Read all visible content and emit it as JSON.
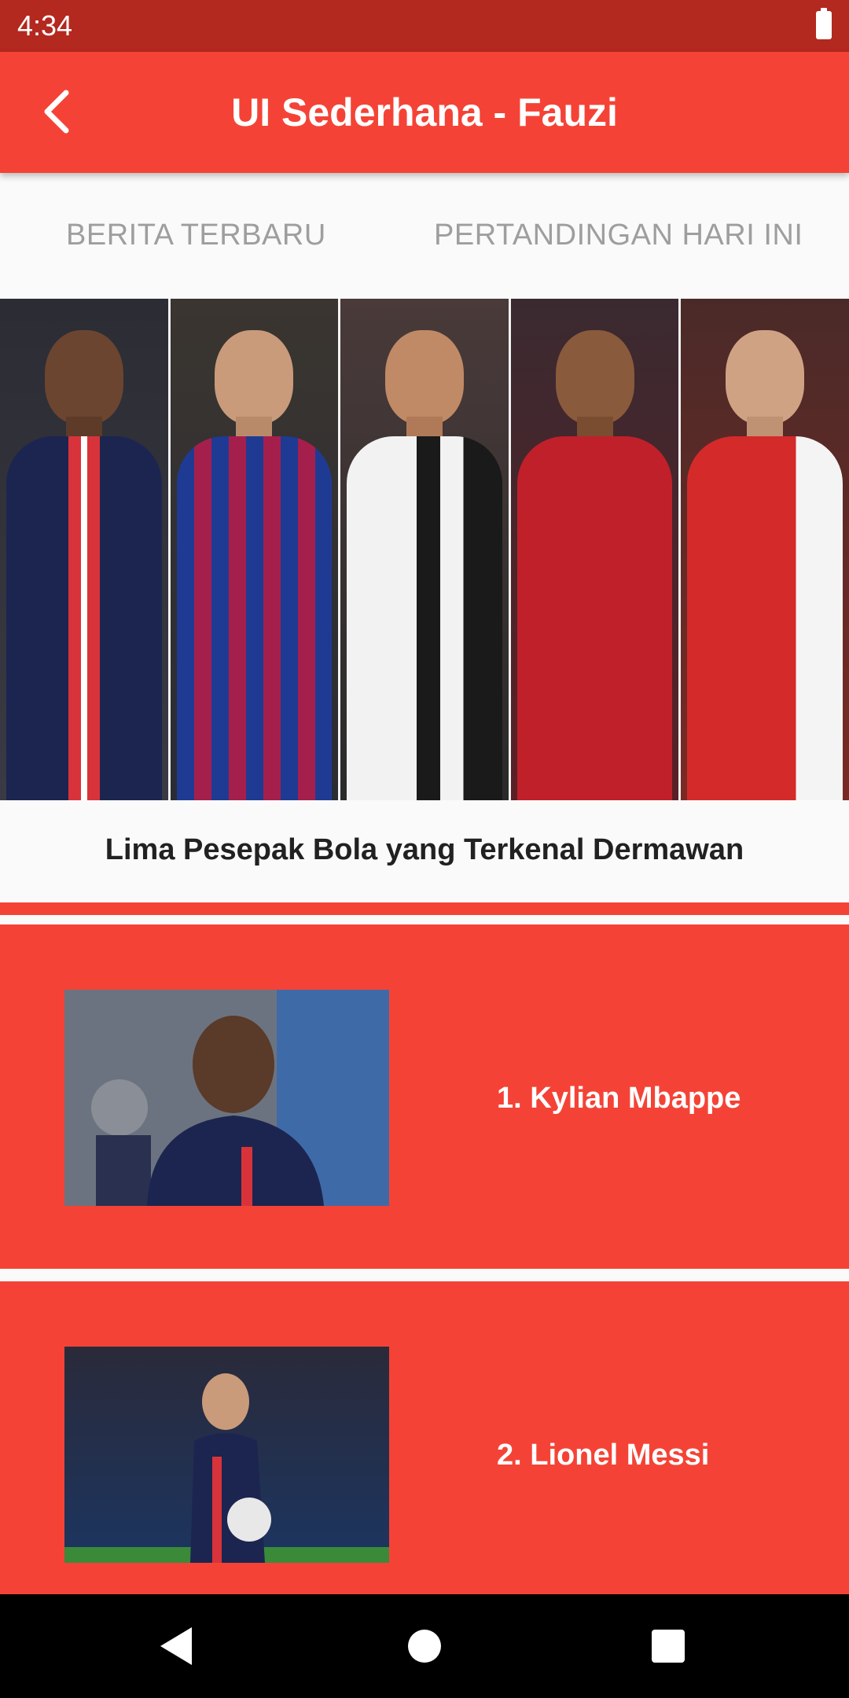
{
  "status_bar": {
    "time": "4:34"
  },
  "app_bar": {
    "title": "UI Sederhana - Fauzi"
  },
  "tabs": [
    {
      "label": "BERITA TERBARU"
    },
    {
      "label": "PERTANDINGAN HARI INI"
    }
  ],
  "hero": {
    "image": "five-footballers-collage",
    "caption": "Lima Pesepak Bola yang Terkenal Dermawan"
  },
  "players": [
    {
      "name": "1. Kylian Mbappe",
      "image": "mbappe-photo"
    },
    {
      "name": "2. Lionel Messi",
      "image": "messi-photo"
    }
  ],
  "colors": {
    "primary": "#f44336",
    "status_bar": "#b3281f",
    "tab_text": "#9e9e9e",
    "background": "#fafafa"
  }
}
